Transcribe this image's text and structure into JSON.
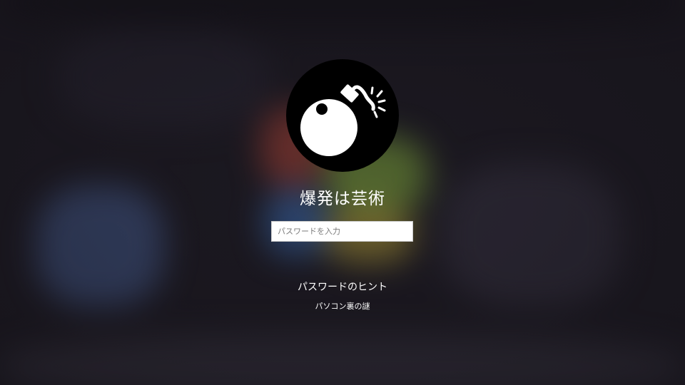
{
  "user": {
    "name": "爆発は芸術",
    "avatar_icon": "bomb-icon"
  },
  "password": {
    "placeholder": "パスワードを入力",
    "value": ""
  },
  "hint": {
    "link_label": "パスワードのヒント",
    "text": "パソコン裏の謎"
  },
  "colors": {
    "avatar_bg": "#000000",
    "text": "#ffffff",
    "input_bg": "#ffffff"
  }
}
